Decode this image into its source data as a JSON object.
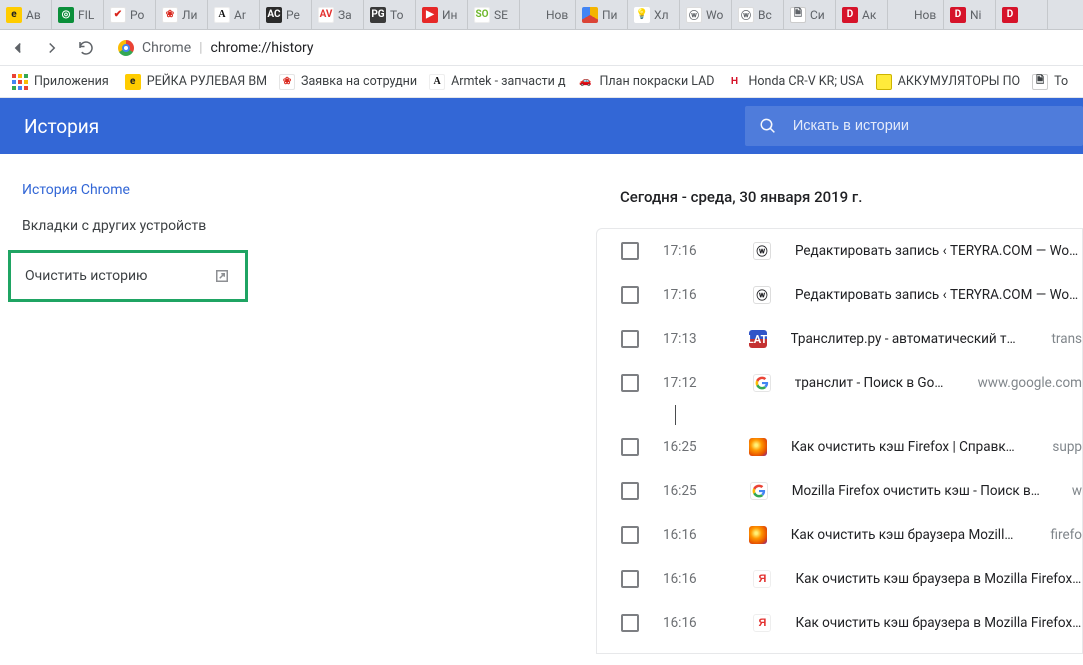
{
  "tabs": [
    {
      "label": "Ав",
      "icon": "fc-e",
      "glyph": "e"
    },
    {
      "label": "FIL",
      "icon": "fc-green",
      "glyph": "◎"
    },
    {
      "label": "Ро",
      "icon": "fc-shell",
      "glyph": "✔"
    },
    {
      "label": "Ли",
      "icon": "fc-shell",
      "glyph": "❀"
    },
    {
      "label": "Ar",
      "icon": "fc-A",
      "glyph": "A"
    },
    {
      "label": "Ре",
      "icon": "fc-ac",
      "glyph": "AC"
    },
    {
      "label": "За",
      "icon": "fc-av",
      "glyph": "AV"
    },
    {
      "label": "То",
      "icon": "fc-pg",
      "glyph": "PG"
    },
    {
      "label": "Ин",
      "icon": "fc-red",
      "glyph": "▶"
    },
    {
      "label": "SE",
      "icon": "fc-so",
      "glyph": "SO"
    },
    {
      "label": "Новая",
      "icon": "",
      "glyph": ""
    },
    {
      "label": "Пи",
      "icon": "fc-pie",
      "glyph": ""
    },
    {
      "label": "Хл",
      "icon": "fc-bulb",
      "glyph": "💡"
    },
    {
      "label": "Wo",
      "icon": "fc-wp",
      "glyph": "ⓦ"
    },
    {
      "label": "Вс",
      "icon": "fc-wp",
      "glyph": "ⓦ"
    },
    {
      "label": "Си",
      "icon": "fc-page",
      "glyph": "🗎"
    },
    {
      "label": "Ак",
      "icon": "fc-D",
      "glyph": "D"
    },
    {
      "label": "Новая",
      "icon": "",
      "glyph": ""
    },
    {
      "label": "Ni",
      "icon": "fc-D",
      "glyph": "D"
    },
    {
      "label": "",
      "icon": "fc-D",
      "glyph": "D"
    }
  ],
  "address": {
    "domain": "Chrome",
    "path": "chrome://history"
  },
  "bookmarks": {
    "apps_label": "Приложения",
    "items": [
      {
        "label": "РЕЙКА РУЛЕВАЯ BM",
        "icon": "fc-e",
        "glyph": "e"
      },
      {
        "label": "Заявка на сотрудни",
        "icon": "fc-shell",
        "glyph": "❀"
      },
      {
        "label": "Armtek - запчасти д",
        "icon": "fc-A",
        "glyph": "A"
      },
      {
        "label": "План покраски LAD",
        "icon": "fc-car",
        "glyph": "🚗"
      },
      {
        "label": "Honda CR-V KR; USA",
        "icon": "fc-honda",
        "glyph": "H"
      },
      {
        "label": "АККУМУЛЯТОРЫ ПО",
        "icon": "fc-batt",
        "glyph": ""
      },
      {
        "label": "To",
        "icon": "fc-page",
        "glyph": "🗎"
      }
    ]
  },
  "history": {
    "title": "История",
    "search_placeholder": "Искать в истории",
    "nav": {
      "chrome": "История Chrome",
      "other": "Вкладки с других устройств",
      "clear": "Очистить историю"
    },
    "date_heading": "Сегодня - среда, 30 января 2019 г.",
    "rows": [
      {
        "time": "17:16",
        "icon": "fc-wp",
        "glyph": "ⓦ",
        "title": "Редактировать запись ‹ TERYRA.COM — WordPres",
        "domain": ""
      },
      {
        "time": "17:16",
        "icon": "fc-wp",
        "glyph": "ⓦ",
        "title": "Редактировать запись ‹ TERYRA.COM — WordPres",
        "domain": ""
      },
      {
        "time": "17:13",
        "icon": "fc-lat",
        "glyph": "LAT",
        "title": "Транслитер.ру - автоматический транслит",
        "domain": "trans"
      },
      {
        "time": "17:12",
        "icon": "fc-g",
        "glyph": "G",
        "title": "транслит - Поиск в Google",
        "domain": "www.google.com"
      },
      {
        "time": "16:25",
        "icon": "fc-ff",
        "glyph": "",
        "title": "Как очистить кэш Firefox | Справка Firefox",
        "domain": "supp"
      },
      {
        "time": "16:25",
        "icon": "fc-g",
        "glyph": "G",
        "title": "Mozilla Firefox очистить кэш - Поиск в Google",
        "domain": "w"
      },
      {
        "time": "16:16",
        "icon": "fc-ff",
        "glyph": "",
        "title": "Как очистить кэш браузера Mozilla Firefox",
        "domain": "firefo"
      },
      {
        "time": "16:16",
        "icon": "fc-ya",
        "glyph": "Я",
        "title": "Как очистить кэш браузера в Mozilla Firefox — Ян",
        "domain": ""
      },
      {
        "time": "16:16",
        "icon": "fc-ya",
        "glyph": "Я",
        "title": "Как очистить кэш браузера в Mozilla Firefox — Ян",
        "domain": ""
      }
    ]
  }
}
